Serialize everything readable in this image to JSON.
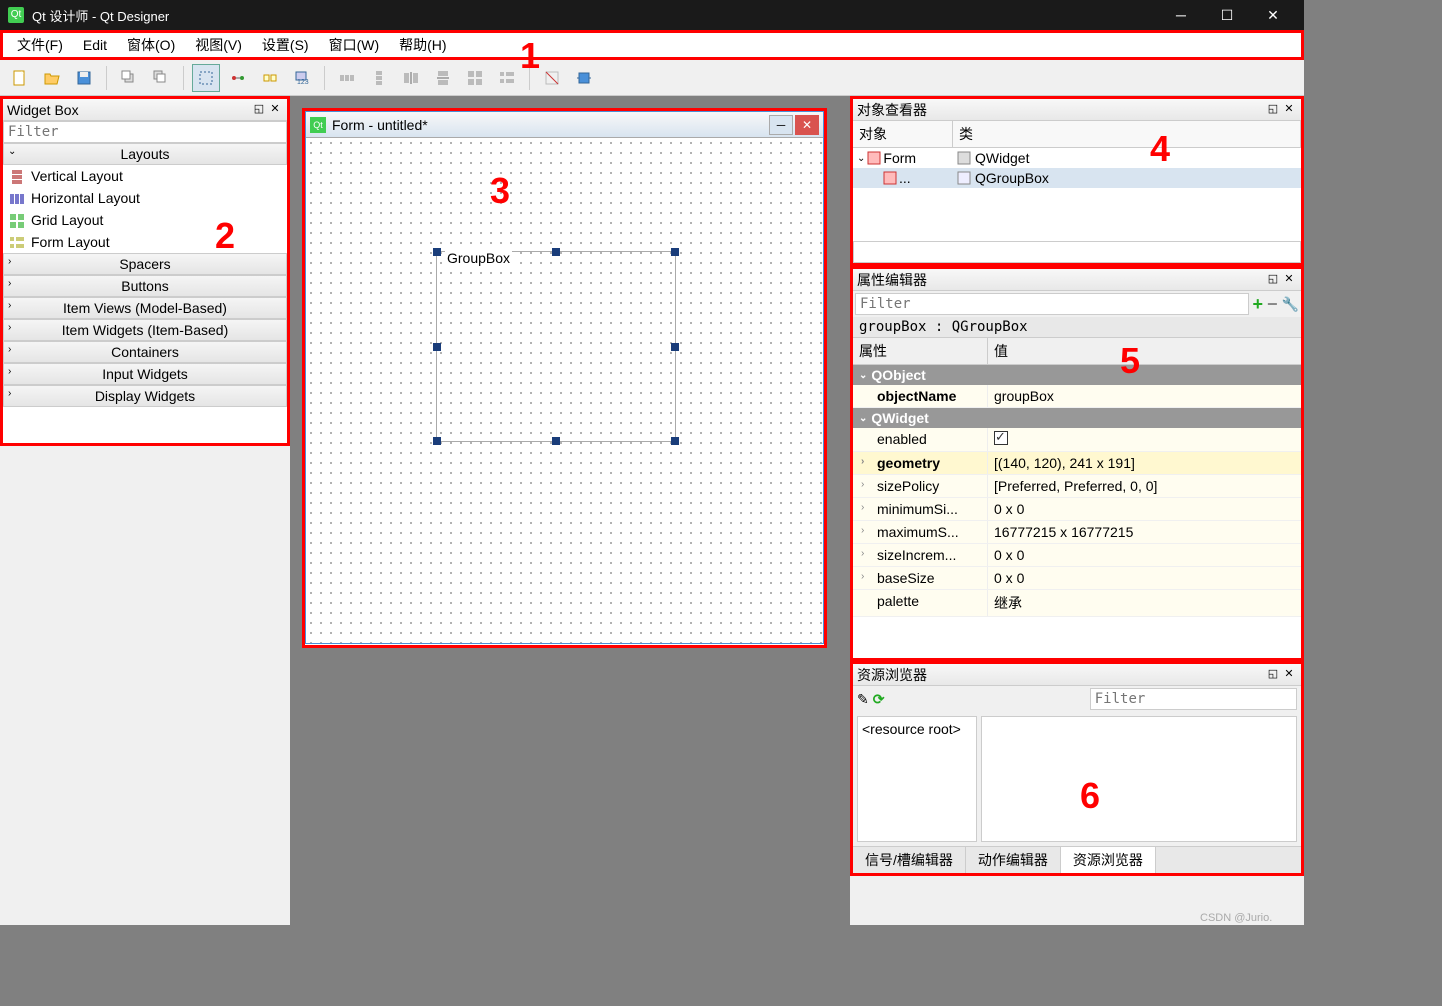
{
  "titlebar": {
    "title": "Qt 设计师 - Qt Designer"
  },
  "menubar": {
    "file": "文件(F)",
    "edit": "Edit",
    "form": "窗体(O)",
    "view": "视图(V)",
    "settings": "设置(S)",
    "window": "窗口(W)",
    "help": "帮助(H)"
  },
  "widgetBox": {
    "title": "Widget Box",
    "filterPlaceholder": "Filter",
    "categories": {
      "layouts": "Layouts",
      "spacers": "Spacers",
      "buttons": "Buttons",
      "itemViews": "Item Views (Model-Based)",
      "itemWidgets": "Item Widgets (Item-Based)",
      "containers": "Containers",
      "inputWidgets": "Input Widgets",
      "displayWidgets": "Display Widgets"
    },
    "layoutItems": {
      "vertical": "Vertical Layout",
      "horizontal": "Horizontal Layout",
      "grid": "Grid Layout",
      "form": "Form Layout"
    }
  },
  "formDesigner": {
    "title": "Form - untitled*",
    "groupBoxLabel": "GroupBox"
  },
  "objectInspector": {
    "title": "对象查看器",
    "colObject": "对象",
    "colClass": "类",
    "rows": {
      "form": {
        "name": "Form",
        "class": "QWidget"
      },
      "groupbox": {
        "name": "...",
        "class": "QGroupBox"
      }
    }
  },
  "propertyEditor": {
    "title": "属性编辑器",
    "filterPlaceholder": "Filter",
    "objectLabel": "groupBox : QGroupBox",
    "colProperty": "属性",
    "colValue": "值",
    "groups": {
      "qobject": "QObject",
      "qwidget": "QWidget"
    },
    "props": {
      "objectName": {
        "name": "objectName",
        "value": "groupBox"
      },
      "enabled": {
        "name": "enabled"
      },
      "geometry": {
        "name": "geometry",
        "value": "[(140, 120), 241 x 191]"
      },
      "sizePolicy": {
        "name": "sizePolicy",
        "value": "[Preferred, Preferred, 0, 0]"
      },
      "minimumSize": {
        "name": "minimumSi...",
        "value": "0 x 0"
      },
      "maximumSize": {
        "name": "maximumS...",
        "value": "16777215 x 16777215"
      },
      "sizeIncrement": {
        "name": "sizeIncrem...",
        "value": "0 x 0"
      },
      "baseSize": {
        "name": "baseSize",
        "value": "0 x 0"
      },
      "palette": {
        "name": "palette",
        "value": "继承"
      }
    }
  },
  "resourceBrowser": {
    "title": "资源浏览器",
    "filterPlaceholder": "Filter",
    "root": "<resource root>",
    "tabs": {
      "signals": "信号/槽编辑器",
      "actions": "动作编辑器",
      "resources": "资源浏览器"
    }
  },
  "annotations": {
    "a1": "1",
    "a2": "2",
    "a3": "3",
    "a4": "4",
    "a5": "5",
    "a6": "6"
  },
  "watermark": "CSDN @Jurio."
}
